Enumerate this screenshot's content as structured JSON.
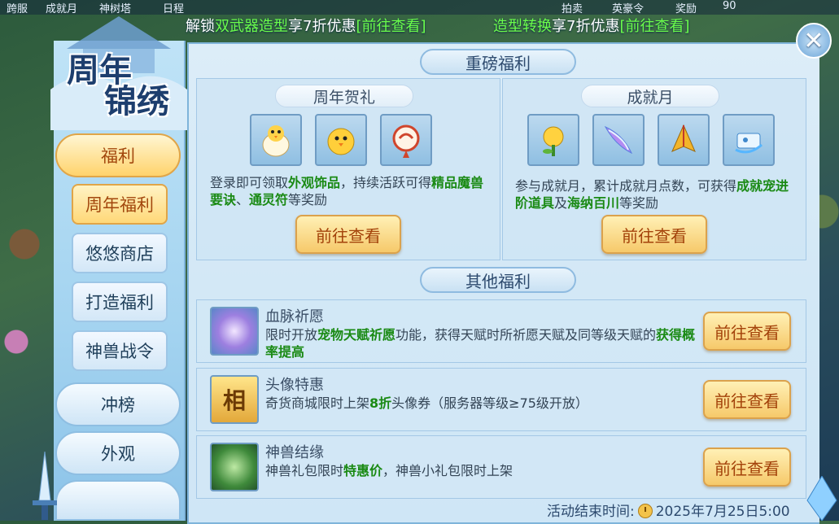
{
  "topbar": {
    "items": [
      "跨服",
      "成就月",
      "神树塔",
      "日程",
      "拍卖",
      "英豪令",
      "奖励",
      "90"
    ]
  },
  "banner": {
    "left": {
      "prefix": "解锁",
      "highlight": "双武器造型",
      "mid": "享7折优惠",
      "link": "[前往查看]"
    },
    "right": {
      "highlight": "造型转换",
      "mid": "享7折优惠",
      "link": "[前往查看]"
    }
  },
  "logo": {
    "line1": "周年",
    "line2": "锦绣"
  },
  "nav": {
    "fuli": "福利",
    "sub": [
      "周年福利",
      "悠悠商店",
      "打造福利",
      "神兽战令"
    ],
    "chongbang": "冲榜",
    "waiguan": "外观"
  },
  "main": {
    "section1": "重磅福利",
    "section2": "其他福利",
    "card_left": {
      "title": "周年贺礼",
      "desc_a": "登录即可领取",
      "desc_h1": "外观饰品",
      "desc_b": "，持续活跃可得",
      "desc_h2": "精品魔兽要诀",
      "desc_c": "、",
      "desc_h3": "通灵符",
      "desc_d": "等奖励",
      "button": "前往查看",
      "items": [
        "chick-egg-icon",
        "yellow-bird-icon",
        "red-charm-icon"
      ]
    },
    "card_right": {
      "title": "成就月",
      "desc_a": "参与成就月，累计成就月点数，可获得",
      "desc_h1": "成就宠进阶道具",
      "desc_b": "及",
      "desc_h2": "海纳百川",
      "desc_c": "等奖励",
      "button": "前往查看",
      "items": [
        "golden-flower-icon",
        "crystal-blade-icon",
        "golden-armor-icon",
        "blue-scroll-icon"
      ]
    },
    "rows": [
      {
        "title": "血脉祈愿",
        "a": "限时开放",
        "h1": "宠物天赋祈愿",
        "b": "功能，获得天赋时所祈愿天赋及同等级天赋的",
        "h2": "获得概率提高",
        "c": "",
        "button": "前往查看"
      },
      {
        "title": "头像特惠",
        "a": "奇货商城限时上架",
        "h1": "8折",
        "b": "头像券（服务器等级≥75级开放）",
        "h2": "",
        "c": "",
        "button": "前往查看"
      },
      {
        "title": "神兽结缘",
        "a": "神兽礼包限时",
        "h1": "特惠价",
        "b": "，神兽小礼包限时上架",
        "h2": "",
        "c": "",
        "button": "前往查看"
      }
    ],
    "icon_char": "相"
  },
  "footer": {
    "label": "活动结束时间:",
    "time": "2025年7月25日5:00"
  },
  "close_symbol": "✕"
}
